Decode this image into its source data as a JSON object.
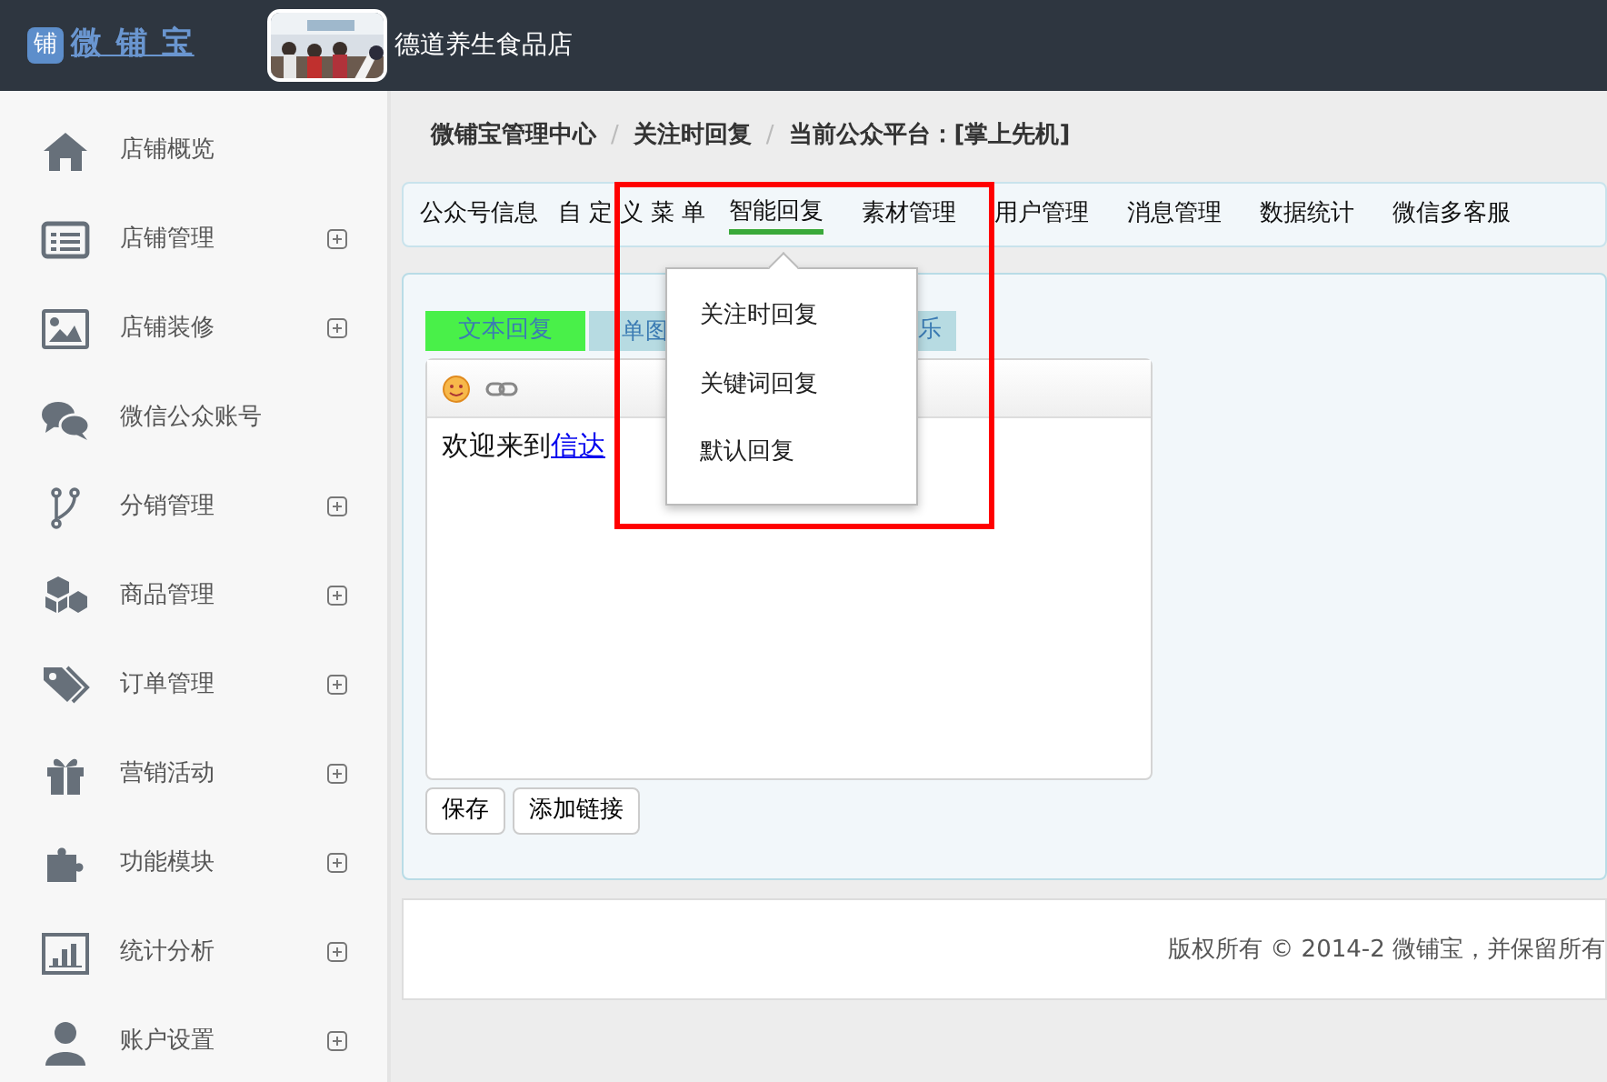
{
  "header": {
    "logo": {
      "mark": "铺",
      "text": "微 铺 宝"
    },
    "store_name": "德道养生食品店"
  },
  "sidebar": {
    "items": [
      {
        "label": "店铺概览",
        "expandable": false
      },
      {
        "label": "店铺管理",
        "expandable": true
      },
      {
        "label": "店铺装修",
        "expandable": true
      },
      {
        "label": "微信公众账号",
        "expandable": false
      },
      {
        "label": "分销管理",
        "expandable": true
      },
      {
        "label": "商品管理",
        "expandable": true
      },
      {
        "label": "订单管理",
        "expandable": true
      },
      {
        "label": "营销活动",
        "expandable": true
      },
      {
        "label": "功能模块",
        "expandable": true
      },
      {
        "label": "统计分析",
        "expandable": true
      },
      {
        "label": "账户设置",
        "expandable": true
      }
    ]
  },
  "breadcrumb": {
    "separator": "/",
    "items": [
      "微铺宝管理中心",
      "关注时回复",
      "当前公众平台：[掌上先机]"
    ]
  },
  "nav_tabs": [
    {
      "label": "公众号信息",
      "selected": false
    },
    {
      "label": "自定义菜单",
      "selected": false
    },
    {
      "label": "智能回复",
      "selected": true
    },
    {
      "label": "素材管理",
      "selected": false
    },
    {
      "label": "用户管理",
      "selected": false
    },
    {
      "label": "消息管理",
      "selected": false
    },
    {
      "label": "数据统计",
      "selected": false
    },
    {
      "label": "微信多客服",
      "selected": false
    }
  ],
  "dropdown": {
    "items": [
      "关注时回复",
      "关键词回复",
      "默认回复"
    ]
  },
  "reply_tabs": [
    {
      "label": "文本回复",
      "selected": true
    },
    {
      "label": "单图",
      "selected": false
    },
    {
      "label": "乐",
      "selected": false
    }
  ],
  "editor": {
    "text": "欢迎来到",
    "link": "信达"
  },
  "buttons": [
    "保存",
    "添加链接"
  ],
  "footer": {
    "text": "版权所有 © 2014-2 微铺宝，并保留所有"
  }
}
